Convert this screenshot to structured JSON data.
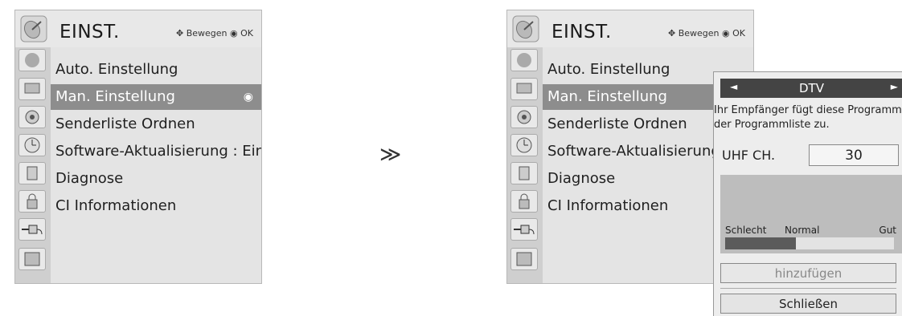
{
  "menu": {
    "title": "EINST.",
    "hint": "Bewegen",
    "ok": "OK",
    "items": [
      {
        "label": "Auto. Einstellung"
      },
      {
        "label": "Man. Einstellung"
      },
      {
        "label": "Senderliste Ordnen"
      },
      {
        "label": "Software-Aktualisierung : Ein"
      },
      {
        "label": "Diagnose"
      },
      {
        "label": "CI Informationen"
      }
    ],
    "right_items": [
      {
        "label": "Auto. Einstellung"
      },
      {
        "label": "Man. Einstellung"
      },
      {
        "label": "Senderliste Ordnen"
      },
      {
        "label": "Software-Aktualisierung :"
      },
      {
        "label": "Diagnose"
      },
      {
        "label": "CI Informationen"
      }
    ],
    "selected_index": 1
  },
  "arrow": "≫",
  "popup": {
    "mode": "DTV",
    "description_line1": "Ihr Empfänger fügt diese Programme",
    "description_line2": "der Programmliste zu.",
    "channel_label": "UHF CH.",
    "channel_value": "30",
    "signal": {
      "bad_label": "Schlecht",
      "normal_label": "Normal",
      "good_label": "Gut",
      "level": 0.42
    },
    "add_button": "hinzufügen",
    "close_button": "Schließen"
  },
  "colors": {
    "selected": "#8d8d8d",
    "menu_bg": "#e4e4e4",
    "icon_col": "#cfcfcf"
  }
}
